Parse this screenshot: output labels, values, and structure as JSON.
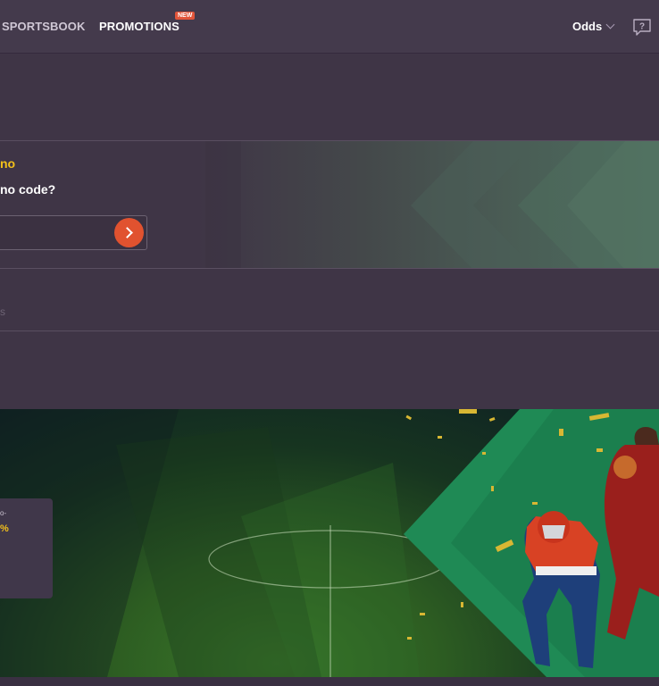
{
  "nav": {
    "sportsbook": "SPORTSBOOK",
    "promotions": "PROMOTIONS",
    "new_badge": "NEW",
    "odds": "Odds"
  },
  "promo": {
    "title": "no",
    "question": "no code?",
    "input_value": "",
    "accent": "#f3c01a",
    "button_color": "#e1522f"
  },
  "section": {
    "faint_text": "s"
  },
  "hero": {
    "card_line1": "o-",
    "card_line2": "%"
  },
  "icons": {
    "help": "help-bubble-icon",
    "submit": "chevron-right-icon",
    "dropdown": "chevron-down-icon"
  }
}
